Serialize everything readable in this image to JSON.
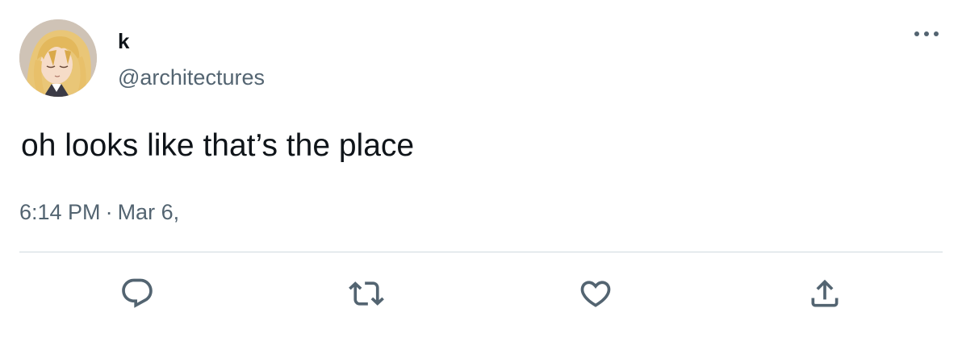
{
  "author": {
    "display_name": "k",
    "handle": "@architectures",
    "avatar_icon": "anime-character-avatar"
  },
  "tweet": {
    "text": "oh looks like that’s the place",
    "time": "6:14 PM",
    "separator": "·",
    "date": "Mar 6,"
  },
  "actions": [
    {
      "name": "reply",
      "icon": "comment-icon"
    },
    {
      "name": "retweet",
      "icon": "retweet-icon"
    },
    {
      "name": "like",
      "icon": "heart-icon"
    },
    {
      "name": "share",
      "icon": "share-icon"
    }
  ],
  "more_icon": "more-options-icon",
  "colors": {
    "text": "#0f1419",
    "secondary": "#536471",
    "divider": "#cfd9de"
  }
}
